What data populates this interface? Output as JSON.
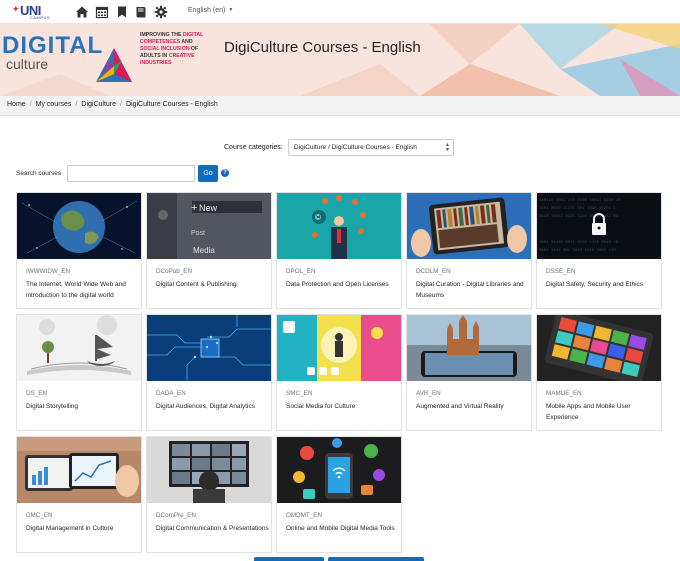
{
  "navbar": {
    "logo_text": "UNI",
    "logo_sub": "CAMPUS",
    "icons": [
      "home-icon",
      "calendar-icon",
      "bookmark-icon",
      "book-icon",
      "gear-icon"
    ],
    "language": "English (en)"
  },
  "banner": {
    "brand_top": "DIGITAL",
    "brand_bottom": "culture",
    "tagline_parts": [
      "IMPROVING THE ",
      "DIGITAL COMPETENCES",
      " AND ",
      "SOCIAL INCLUSION",
      " OF ",
      "ADULTS IN ",
      "CREATIVE INDUSTRIES"
    ],
    "title": "DigiCulture Courses - English"
  },
  "breadcrumb": [
    "Home",
    "My courses",
    "DigiCulture",
    "DigiCulture Courses - English"
  ],
  "filters": {
    "category_label": "Course categories:",
    "category_value": "DigiCulture / DigiCulture Courses - English",
    "search_label": "Search courses",
    "search_value": "",
    "go_label": "Go"
  },
  "courses": [
    {
      "code": "IWWWIDW_EN",
      "title": "The Internet, World Wide Web and introduction to the digital world",
      "image": "globe-network-image"
    },
    {
      "code": "DCoPub_EN",
      "title": "Digital Content & Publishing",
      "image": "new-post-media-image",
      "img_words": [
        "New",
        "Post",
        "Media"
      ]
    },
    {
      "code": "DPOL_EN",
      "title": "Data Protection and Open Licenses",
      "image": "copyright-juggler-image"
    },
    {
      "code": "DCDLM_EN",
      "title": "Digital Curation - Digital Libraries and Museums",
      "image": "tablet-library-image"
    },
    {
      "code": "DSSE_EN",
      "title": "Digital Safety, Security and Ethics",
      "image": "padlock-code-image"
    },
    {
      "code": "DS_EN",
      "title": "Digital Storytelling",
      "image": "open-book-ship-image"
    },
    {
      "code": "DADA_EN",
      "title": "Digital Audiences, Digital Analytics",
      "image": "circuit-board-image"
    },
    {
      "code": "SMC_EN",
      "title": "Social Media for Culture",
      "image": "social-media-collage-image"
    },
    {
      "code": "AVR_EN",
      "title": "Augmented and Virtual Reality",
      "image": "phone-castle-image"
    },
    {
      "code": "MAMUE_EN",
      "title": "Mobile Apps and Mobile User Experience",
      "image": "app-tiles-tablet-image"
    },
    {
      "code": "DMC_EN",
      "title": "Digital Management in Culture",
      "image": "tablet-charts-image"
    },
    {
      "code": "DComPre_EN",
      "title": "Digital Communication & Presentations",
      "image": "video-conference-image"
    },
    {
      "code": "OMDMT_EN",
      "title": "Online and Mobile Digital Media Tools",
      "image": "mobile-media-icons-image"
    }
  ],
  "colors": {
    "primary": "#0f6cbf",
    "brand_blue": "#2a73b8",
    "brand_pink": "#d21c5b"
  }
}
